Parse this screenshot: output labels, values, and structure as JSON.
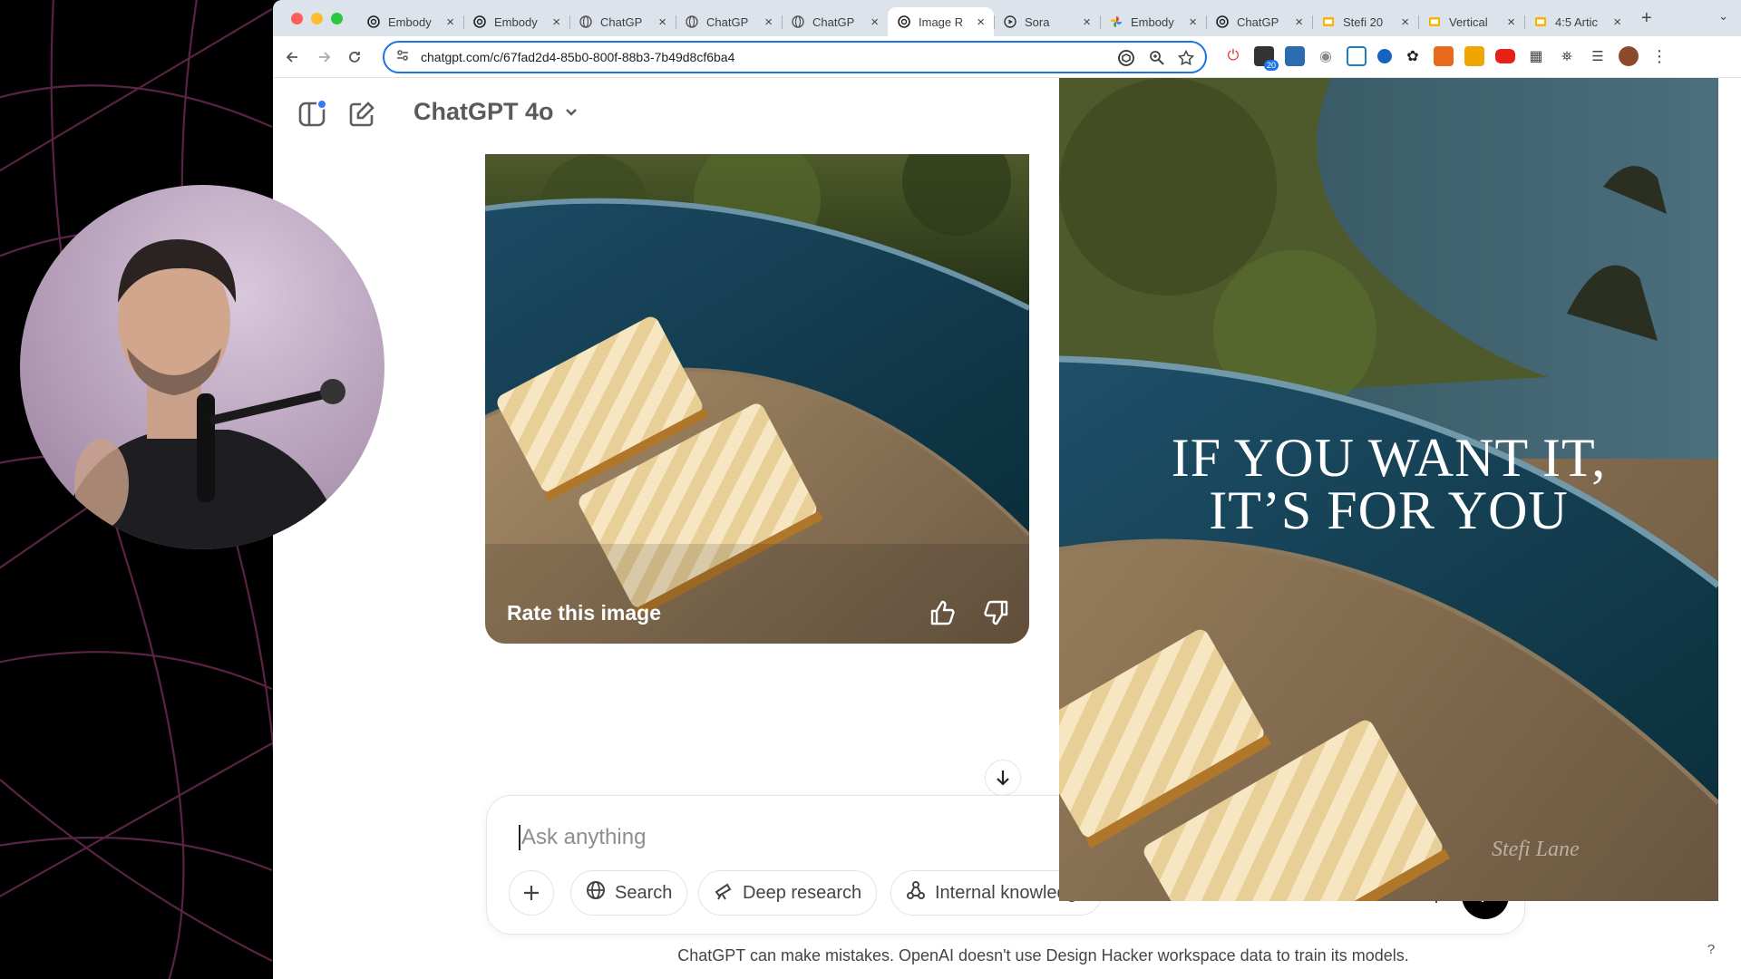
{
  "browser": {
    "tabs": [
      {
        "title": "Embody",
        "icon": "openai-icon",
        "active": false
      },
      {
        "title": "Embody",
        "icon": "openai-icon",
        "active": false
      },
      {
        "title": "ChatGP",
        "icon": "globe-icon",
        "active": false
      },
      {
        "title": "ChatGP",
        "icon": "globe-icon",
        "active": false
      },
      {
        "title": "ChatGP",
        "icon": "globe-icon",
        "active": false
      },
      {
        "title": "Image R",
        "icon": "openai-icon",
        "active": true
      },
      {
        "title": "Sora",
        "icon": "play-icon",
        "active": false
      },
      {
        "title": "Embody",
        "icon": "pinwheel-icon",
        "active": false
      },
      {
        "title": "ChatGP",
        "icon": "openai-icon",
        "active": false
      },
      {
        "title": "Stefi 20",
        "icon": "slides-icon",
        "active": false
      },
      {
        "title": "Vertical",
        "icon": "slides-icon",
        "active": false
      },
      {
        "title": "4:5 Artic",
        "icon": "slides-icon",
        "active": false
      }
    ],
    "url": "chatgpt.com/c/67fad2d4-85b0-800f-88b3-7b49d8cf6ba4",
    "extension_badge": "20",
    "colors": {
      "tabstrip": "#dde3ea",
      "omnibox_border": "#1a73e8"
    }
  },
  "chatgpt": {
    "model_title": "ChatGPT 4o",
    "rate_label": "Rate this image",
    "composer_placeholder": "Ask anything",
    "tools": {
      "search": "Search",
      "deep_research": "Deep research",
      "internal_knowledge": "Internal knowledge"
    },
    "disclaimer": "ChatGPT can make mistakes. OpenAI doesn't use Design Hacker workspace data to train its models.",
    "help": "?"
  },
  "poster": {
    "line1": "IF YOU WANT IT,",
    "line2": "IT’S FOR YOU",
    "signature": "Stefi Lane"
  }
}
